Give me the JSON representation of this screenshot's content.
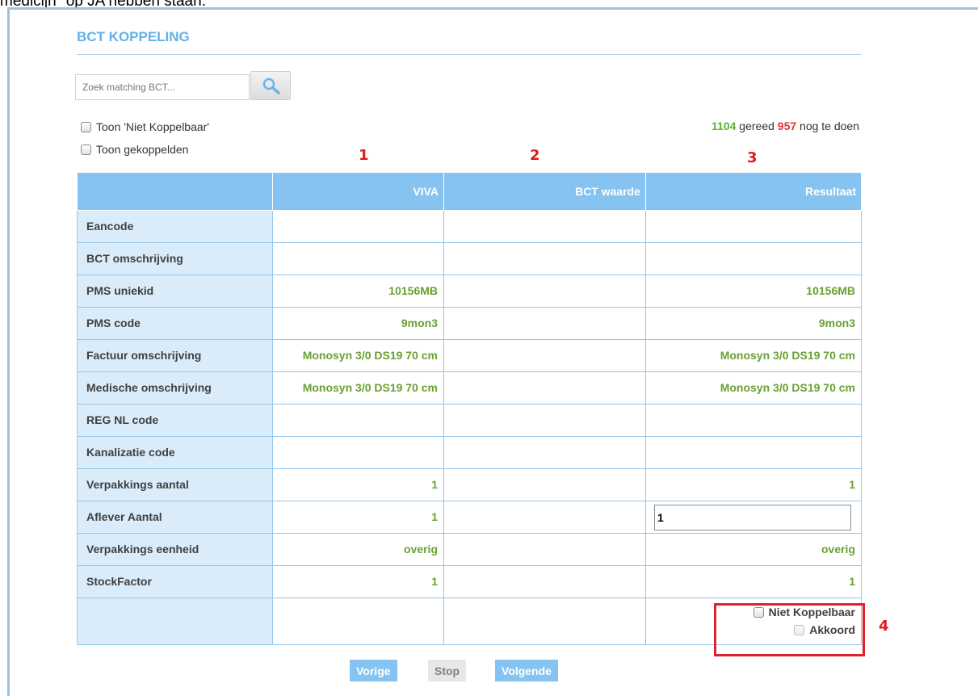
{
  "note": "medicijn\" op JA hebben staan.",
  "title": "BCT KOPPELING",
  "search": {
    "placeholder": "Zoek matching BCT..."
  },
  "filters": {
    "show_not_linkable": "Toon 'Niet Koppelbaar'",
    "show_linked": "Toon gekoppelden"
  },
  "status": {
    "done": "1104",
    "done_label": "gereed",
    "todo": "957",
    "todo_label": "nog te doen"
  },
  "annotations": [
    "1",
    "2",
    "3",
    "4"
  ],
  "table": {
    "headers": [
      "",
      "VIVA",
      "BCT waarde",
      "Resultaat"
    ],
    "rows": [
      {
        "label": "Eancode",
        "viva": "",
        "bct": "",
        "result": ""
      },
      {
        "label": "BCT omschrijving",
        "viva": "",
        "bct": "",
        "result": ""
      },
      {
        "label": "PMS uniekid",
        "viva": "10156MB",
        "bct": "",
        "result": "10156MB"
      },
      {
        "label": "PMS code",
        "viva": "9mon3",
        "bct": "",
        "result": "9mon3"
      },
      {
        "label": "Factuur omschrijving",
        "viva": "Monosyn 3/0 DS19 70 cm",
        "bct": "",
        "result": "Monosyn 3/0 DS19 70 cm"
      },
      {
        "label": "Medische omschrijving",
        "viva": "Monosyn 3/0 DS19 70 cm",
        "bct": "",
        "result": "Monosyn 3/0 DS19 70 cm"
      },
      {
        "label": "REG NL code",
        "viva": "",
        "bct": "",
        "result": ""
      },
      {
        "label": "Kanalizatie code",
        "viva": "",
        "bct": "",
        "result": ""
      },
      {
        "label": "Verpakkings aantal",
        "viva": "1",
        "bct": "",
        "result": "1"
      },
      {
        "label": "Aflever Aantal",
        "viva": "1",
        "bct": "",
        "result_input": "1"
      },
      {
        "label": "Verpakkings eenheid",
        "viva": "overig",
        "bct": "",
        "result": "overig"
      },
      {
        "label": "StockFactor",
        "viva": "1",
        "bct": "",
        "result": "1"
      }
    ],
    "options": {
      "not_linkable": "Niet Koppelbaar",
      "agree": "Akkoord"
    }
  },
  "nav": {
    "prev": "Vorige",
    "stop": "Stop",
    "next": "Volgende"
  },
  "colors": {
    "accent": "#86c3f1",
    "value_green": "#6aa032",
    "done_green": "#5bb333",
    "todo_red": "#e53030",
    "annotation_red": "#e01b1b"
  }
}
